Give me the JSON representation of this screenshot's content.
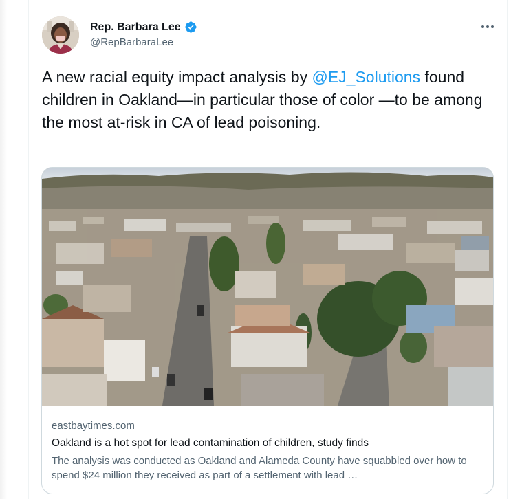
{
  "author": {
    "display_name": "Rep. Barbara Lee",
    "handle": "@RepBarbaraLee",
    "verified_color": "#1d9bf0"
  },
  "tweet": {
    "text_before": "A new racial equity impact analysis by ",
    "mention": "@EJ_Solutions",
    "text_after": " found children in Oakland—in particular those of color —to be among the most at-risk in CA of lead poisoning."
  },
  "card": {
    "domain": "eastbaytimes.com",
    "title": "Oakland is a hot spot for lead contamination of children, study finds",
    "description": "The analysis was conducted as Oakland and Alameda County have squabbled over how to spend $24 million they received as part of a settlement with lead …"
  },
  "icons": {
    "more": "more-horizontal-icon",
    "verified": "verified-badge-icon"
  },
  "colors": {
    "link": "#1d9bf0",
    "secondary_text": "#536471",
    "border": "#cfd9de"
  }
}
